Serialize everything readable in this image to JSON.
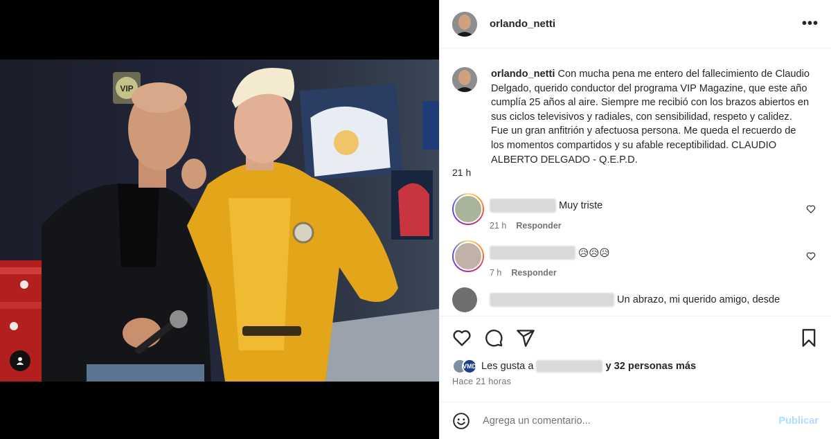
{
  "post": {
    "username": "orlando_netti",
    "caption_text": "Con mucha pena me entero del fallecimiento de Claudio Delgado, querido conductor del programa VIP Magazine, que este año cumplía 25 años al aire. Siempre me recibió con los brazos abiertos en sus ciclos televisivos y radiales, con sensibilidad, respeto y calidez. Fue un gran anfitrión y afectuosa persona. Me queda el recuerdo de los momentos compartidos y su afable receptibilidad. CLAUDIO ALBERTO DELGADO - Q.E.P.D.",
    "caption_time": "21 h",
    "photo_sign": "VIP"
  },
  "comments": [
    {
      "text": "Muy triste",
      "time": "21 h",
      "reply_label": "Responder"
    },
    {
      "text": "😥😥😥",
      "time": "7 h",
      "reply_label": "Responder"
    },
    {
      "text": "Un abrazo, mi querido amigo, desde"
    }
  ],
  "likes": {
    "prefix": "Les gusta a",
    "suffix": "y 32 personas más",
    "badge": "VMD"
  },
  "time_ago": "Hace 21 horas",
  "add_comment": {
    "placeholder": "Agrega un comentario...",
    "post_label": "Publicar"
  },
  "icons": {
    "more": "more-options-icon",
    "like": "heart-icon",
    "comment": "comment-icon",
    "share": "share-icon",
    "save": "bookmark-icon",
    "emoji": "emoji-icon",
    "user_tag": "user-tag-icon"
  },
  "colors": {
    "accent_disabled": "#b3dbff",
    "secondary_text": "#737373",
    "divider": "#efefef"
  }
}
